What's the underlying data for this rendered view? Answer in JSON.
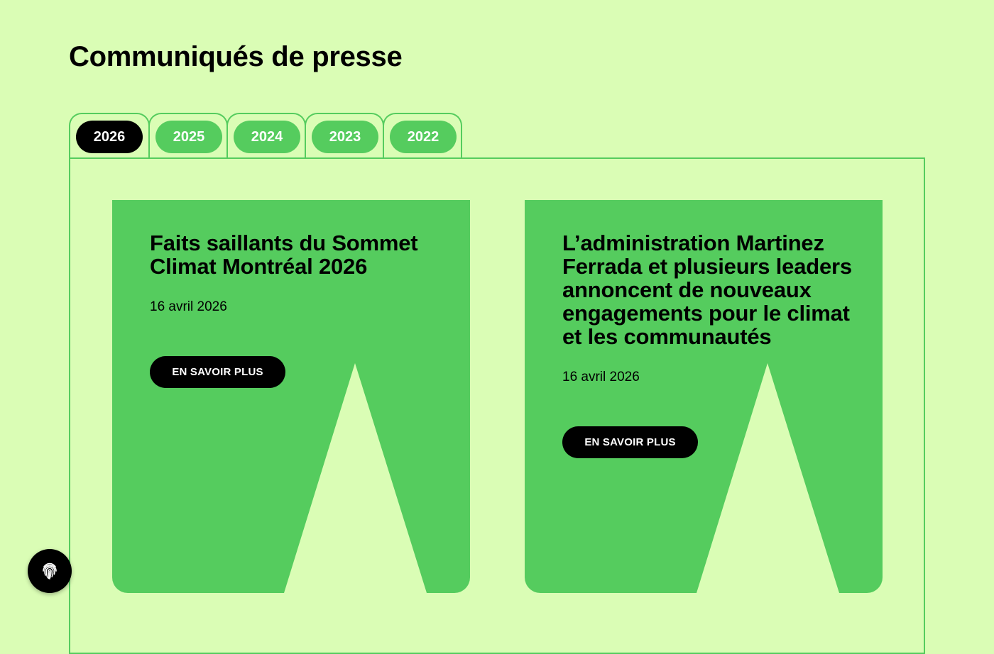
{
  "page": {
    "title": "Communiqués de presse"
  },
  "tabs": [
    {
      "label": "2026",
      "active": true
    },
    {
      "label": "2025",
      "active": false
    },
    {
      "label": "2024",
      "active": false
    },
    {
      "label": "2023",
      "active": false
    },
    {
      "label": "2022",
      "active": false
    }
  ],
  "cards": [
    {
      "title": "Faits saillants du Sommet Climat Montréal 2026",
      "date": "16 avril 2026",
      "button": "EN SAVOIR PLUS"
    },
    {
      "title": "L’administration Martinez Ferrada et plusieurs leaders annoncent de nouveaux engagements pour le climat et les communautés",
      "date": "16 avril 2026",
      "button": "EN SAVOIR PLUS"
    }
  ],
  "floating_button": {
    "icon": "fingerprint-icon"
  },
  "colors": {
    "background": "#dafdb5",
    "accent": "#55cc5e",
    "dark": "#000000"
  }
}
